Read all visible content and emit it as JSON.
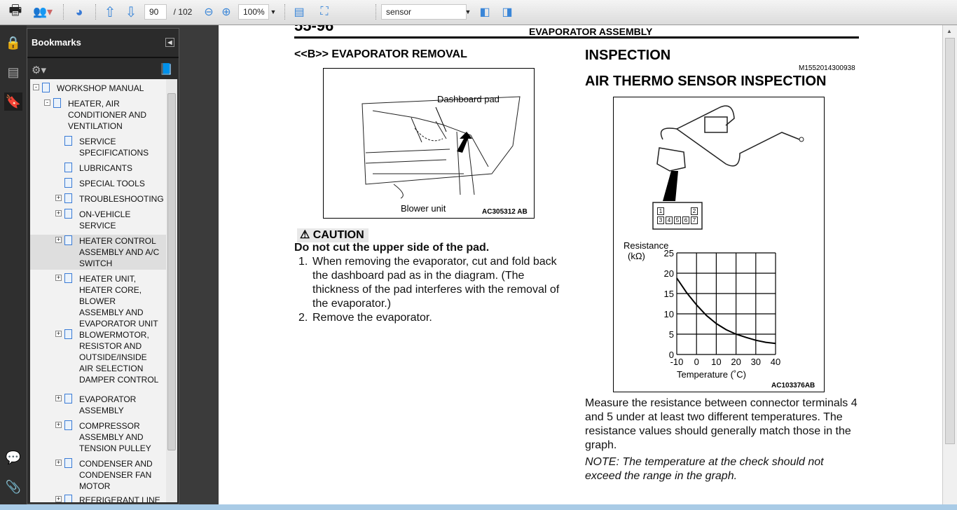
{
  "toolbar": {
    "page_current": "90",
    "page_total": "/ 102",
    "zoom": "100%",
    "search": "sensor",
    "icons": [
      "print-icon",
      "share-icon",
      "security-settings-icon",
      "prev-page-icon",
      "next-page-icon",
      "zoom-out-icon",
      "zoom-in-icon",
      "fit-width-icon",
      "fit-page-icon",
      "find-previous-icon",
      "find-next-icon"
    ]
  },
  "left_strip": {
    "icons": [
      "lock-icon",
      "pages-icon",
      "bookmarks-icon",
      "comments-icon",
      "attachments-icon"
    ]
  },
  "bookmarks": {
    "title": "Bookmarks",
    "items": [
      {
        "label": "WORKSHOP MANUAL",
        "level": 0,
        "toggle": "-"
      },
      {
        "label": "HEATER, AIR CONDITIONER AND VENTILATION",
        "level": 1,
        "toggle": "-"
      },
      {
        "label": "SERVICE SPECIFICATIONS",
        "level": 2,
        "toggle": ""
      },
      {
        "label": "LUBRICANTS",
        "level": 2,
        "toggle": ""
      },
      {
        "label": "SPECIAL TOOLS",
        "level": 2,
        "toggle": ""
      },
      {
        "label": "TROUBLESHOOTING",
        "level": 2,
        "toggle": "+"
      },
      {
        "label": "ON-VEHICLE SERVICE",
        "level": 2,
        "toggle": "+"
      },
      {
        "label": "HEATER CONTROL ASSEMBLY AND A/C SWITCH",
        "level": 2,
        "toggle": "+",
        "selected": true
      },
      {
        "label": "HEATER UNIT, HEATER CORE, BLOWER ASSEMBLY AND EVAPORATOR UNIT",
        "level": 2,
        "toggle": "+"
      },
      {
        "label": "BLOWERMOTOR, RESISTOR AND OUTSIDE/INSIDE AIR SELECTION DAMPER CONTROL",
        "level": 2,
        "toggle": "+"
      },
      {
        "label": "EVAPORATOR ASSEMBLY",
        "level": 2,
        "toggle": "+"
      },
      {
        "label": "COMPRESSOR ASSEMBLY AND TENSION PULLEY",
        "level": 2,
        "toggle": "+"
      },
      {
        "label": "CONDENSER AND CONDENSER FAN MOTOR",
        "level": 2,
        "toggle": "+"
      },
      {
        "label": "REFRIGERANT LINE",
        "level": 2,
        "toggle": "+"
      }
    ]
  },
  "page": {
    "page_number": "55-96",
    "header": "EVAPORATOR ASSEMBLY",
    "left": {
      "heading": "<<B>> EVAPORATOR REMOVAL",
      "figure": {
        "label_pad": "Dashboard pad",
        "label_blower": "Blower unit",
        "code": "AC305312 AB"
      },
      "caution_label": "CAUTION",
      "caution_text": "Do not cut the upper side of the pad.",
      "steps": [
        "When removing the evaporator, cut and fold back the dashboard pad as in the diagram. (The thickness of the pad interferes with the removal of the evaporator.)",
        "Remove the evaporator."
      ]
    },
    "right": {
      "heading": "INSPECTION",
      "doc_code": "M1552014300938",
      "subheading": "AIR THERMO SENSOR INSPECTION",
      "connector_terminals": [
        "1",
        "2",
        "3",
        "4",
        "5",
        "6",
        "7"
      ],
      "figure_code": "AC103376AB",
      "body": "Measure the resistance between connector terminals 4 and 5 under at least two different temperatures. The resistance values should generally match those in the graph.",
      "note": "NOTE: The temperature at the check should not exceed the range in the graph."
    }
  },
  "chart_data": {
    "type": "line",
    "xlabel": "Temperature (˚C)",
    "ylabel": "Resistance",
    "ylabel_unit": "(kΩ)",
    "xlim": [
      -10,
      40
    ],
    "ylim": [
      0,
      25
    ],
    "grid": true,
    "xticks": [
      "-10",
      "0",
      "10",
      "20",
      "30",
      "40"
    ],
    "yticks": [
      "0",
      "5",
      "10",
      "15",
      "20",
      "25"
    ],
    "x": [
      -10,
      -5,
      0,
      5,
      10,
      15,
      20,
      25,
      30,
      35,
      40
    ],
    "y": [
      18.8,
      15.2,
      12.2,
      9.6,
      7.6,
      6.1,
      5.0,
      4.2,
      3.5,
      3.0,
      2.7
    ]
  }
}
